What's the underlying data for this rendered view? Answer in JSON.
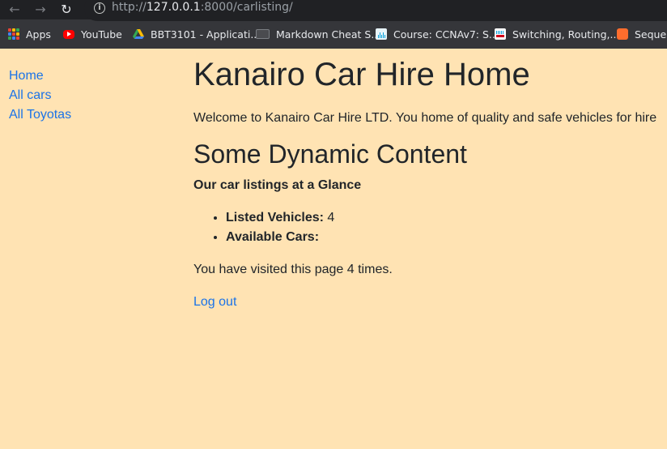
{
  "browser": {
    "url_protocol": "http://",
    "url_host": "127.0.0.1",
    "url_path": ":8000/carlisting/",
    "bookmarks": [
      {
        "label": "Apps",
        "icon": "apps-grid-icon"
      },
      {
        "label": "YouTube",
        "icon": "youtube-icon"
      },
      {
        "label": "BBT3101 - Applicati...",
        "icon": "google-drive-icon"
      },
      {
        "label": "Markdown Cheat S...",
        "icon": "markdown-icon"
      },
      {
        "label": "Course: CCNAv7: S...",
        "icon": "cisco-icon"
      },
      {
        "label": "Switching, Routing,...",
        "icon": "cisco-icon"
      },
      {
        "label": "Sequen",
        "icon": "bookmark-app-icon"
      }
    ]
  },
  "sidebar": {
    "links": [
      {
        "label": "Home"
      },
      {
        "label": "All cars"
      },
      {
        "label": "All Toyotas"
      }
    ]
  },
  "main": {
    "title": "Kanairo Car Hire Home",
    "welcome": "Welcome to Kanairo Car Hire LTD. You home of quality and safe vehicles for hire",
    "dynamic_heading": "Some Dynamic Content",
    "glance_heading": "Our car listings at a Glance",
    "stats": [
      {
        "label": "Listed Vehicles:",
        "value": "4"
      },
      {
        "label": "Available Cars:",
        "value": ""
      }
    ],
    "visits_text": "You have visited this page 4 times.",
    "logout_label": "Log out"
  },
  "colors": {
    "page_background": "#ffe3b3",
    "link": "#1a73e8",
    "text": "#212529",
    "browser_chrome": "#35363a"
  }
}
